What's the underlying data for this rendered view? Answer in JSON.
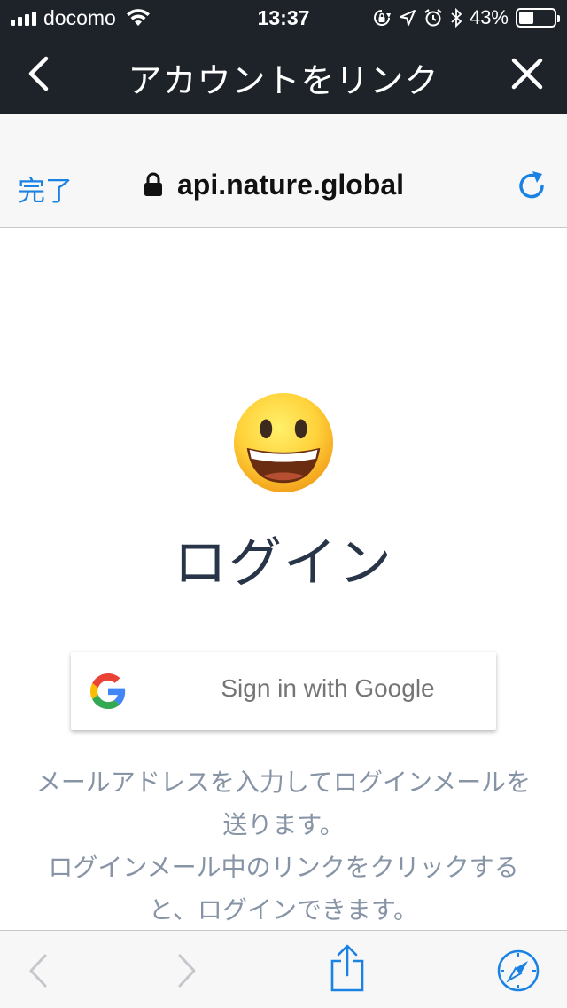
{
  "status_bar": {
    "carrier": "docomo",
    "time": "13:37",
    "battery_percent": "43%",
    "battery_level": 0.43,
    "icons": [
      "signal-bars-icon",
      "wifi-icon",
      "rotation-lock-icon",
      "location-arrow-icon",
      "alarm-icon",
      "bluetooth-icon",
      "battery-icon"
    ]
  },
  "nav": {
    "title": "アカウントをリンク",
    "back_icon": "chevron-left-icon",
    "close_icon": "close-icon"
  },
  "browser": {
    "done_label": "完了",
    "url": "api.nature.global",
    "lock_icon": "lock-icon",
    "reload_icon": "reload-icon"
  },
  "page": {
    "emoji": "grinning-face-emoji",
    "title": "ログイン",
    "google_button_label": "Sign in with Google",
    "description_lines": [
      "メールアドレスを入力してログインメールを",
      "送ります。",
      "ログインメール中のリンクをクリックする",
      "と、ログインできます。"
    ]
  },
  "toolbar": {
    "icons": [
      "back-icon",
      "forward-icon",
      "share-icon",
      "safari-compass-icon"
    ]
  },
  "colors": {
    "header_bg": "#1e2329",
    "accent_blue": "#1a82e2",
    "title_text": "#283447",
    "description_text": "#8794a6"
  }
}
